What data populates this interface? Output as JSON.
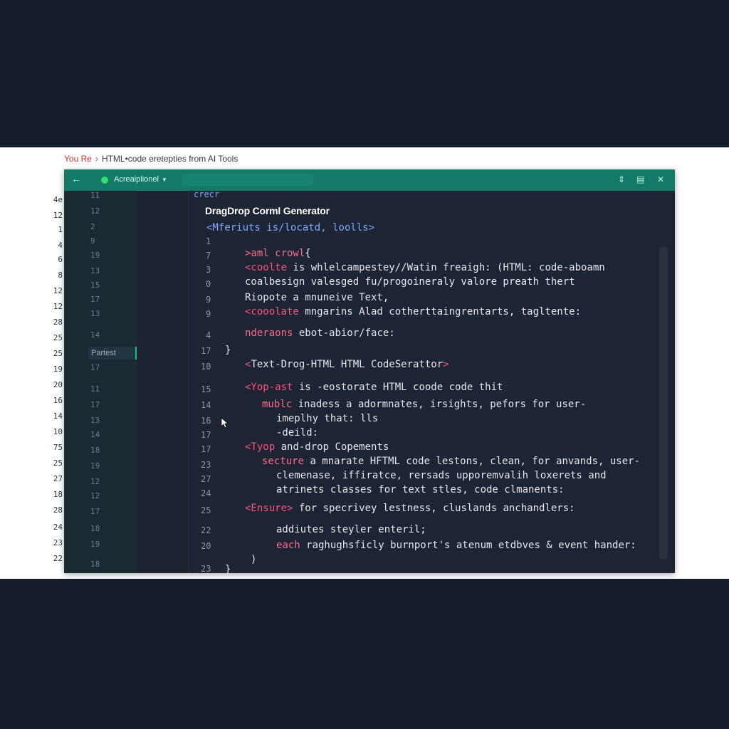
{
  "breadcrumb": {
    "first": "You Re",
    "separator": "›",
    "title": "HTML•code eretepties from AI Tools"
  },
  "window": {
    "tab_label": "Acreaiplionel",
    "gutter_tab": "Partest",
    "section_title": "DragDrop Corml Generator",
    "header_word": "crecr"
  },
  "outer_gutter": [
    "4e",
    "12",
    "1",
    "4",
    "6",
    "8",
    "12",
    "12",
    "28",
    "25",
    "25",
    "19",
    "20",
    "16",
    "14",
    "10",
    "75",
    "25",
    "27",
    "18",
    "28",
    "24",
    "23",
    "22"
  ],
  "inner_gutter": [
    "11",
    "12",
    "2",
    "9",
    "19",
    "13",
    "15",
    "17",
    "13",
    "14",
    "17",
    "11",
    "17",
    "13",
    "14",
    "18",
    "19",
    "12",
    "12",
    "17",
    "18",
    "19",
    "18"
  ],
  "code_nums": [
    "1",
    "7",
    "3",
    "0",
    "9",
    "9",
    "4",
    "17",
    "10",
    "15",
    "14",
    "16",
    "17",
    "17",
    "23",
    "27",
    "24",
    "25",
    "22",
    "20",
    "23"
  ],
  "code_lines": [
    {
      "parts": [
        {
          "t": "<Mferiuts is/locatd, loolls>",
          "c": "blue"
        }
      ]
    },
    {
      "parts": [
        {
          "t": ">aml crowl",
          "c": "kw"
        },
        {
          "t": "{",
          "c": "brace"
        }
      ]
    },
    {
      "parts": [
        {
          "t": "<coolte",
          "c": "tag"
        },
        {
          "t": " is whlelcampestey//Watin freaigh: (HTML: code-aboamn",
          "c": ""
        }
      ]
    },
    {
      "parts": [
        {
          "t": "coalbesign valesged fu/progoineraly valore preath thert",
          "c": ""
        }
      ]
    },
    {
      "parts": [
        {
          "t": "Riopote a mnuneive Text,",
          "c": ""
        }
      ]
    },
    {
      "parts": [
        {
          "t": "<cooolate",
          "c": "tag"
        },
        {
          "t": " mngarins Alad cotherttaingrentarts, tagltente:",
          "c": ""
        }
      ]
    },
    {
      "parts": [
        {
          "t": "nderaons",
          "c": "kw"
        },
        {
          "t": " ebot-abior/face:",
          "c": ""
        }
      ]
    },
    {
      "parts": [
        {
          "t": "}",
          "c": "brace"
        }
      ]
    },
    {
      "parts": [
        {
          "t": "<",
          "c": "tag"
        },
        {
          "t": "Text-Drog-HTML HTML CodeSerattor",
          "c": ""
        },
        {
          "t": ">",
          "c": "tag"
        }
      ]
    },
    {
      "parts": [
        {
          "t": "<Yop-ast",
          "c": "tag"
        },
        {
          "t": " is -eostorate HTML coode code thit",
          "c": ""
        }
      ]
    },
    {
      "parts": [
        {
          "t": "mublc",
          "c": "kw"
        },
        {
          "t": " inadess a adormnates, irsights, pefors for user-",
          "c": ""
        }
      ]
    },
    {
      "parts": [
        {
          "t": "imeplhy that: lls",
          "c": ""
        }
      ]
    },
    {
      "parts": [
        {
          "t": "-deild:",
          "c": ""
        }
      ]
    },
    {
      "parts": [
        {
          "t": "<Tyop",
          "c": "tag"
        },
        {
          "t": " and-drop Copements",
          "c": ""
        }
      ]
    },
    {
      "parts": [
        {
          "t": "secture",
          "c": "kw"
        },
        {
          "t": " a mnarate HFTML code lestons, clean, for anvands, user-",
          "c": ""
        }
      ]
    },
    {
      "parts": [
        {
          "t": "clemenase, iffiratce, rersads upporemvalih loxerets and",
          "c": ""
        }
      ]
    },
    {
      "parts": [
        {
          "t": "atrinets classes for text stles, code clmanents:",
          "c": ""
        }
      ]
    },
    {
      "parts": [
        {
          "t": "<Ensure>",
          "c": "tag"
        },
        {
          "t": " for specrivey lestness, cluslands anchandlers:",
          "c": ""
        }
      ]
    },
    {
      "parts": [
        {
          "t": "addiutes steyler enteril;",
          "c": ""
        }
      ]
    },
    {
      "parts": [
        {
          "t": "each",
          "c": "kw"
        },
        {
          "t": " raghughsficly burnport's atenum etdbves & event hander:",
          "c": ""
        }
      ]
    },
    {
      "parts": [
        {
          "t": ")",
          "c": "brace"
        }
      ]
    },
    {
      "parts": [
        {
          "t": "}",
          "c": "brace"
        }
      ]
    }
  ],
  "icons": {
    "back": "arrow-left-icon",
    "toolbar": [
      "pin-icon",
      "panel-icon",
      "close-icon"
    ]
  },
  "colors": {
    "titlebar": "#127a67",
    "editor_bg": "#1d2434",
    "tag": "#ff4f7a",
    "accent_green": "#2de36a"
  }
}
